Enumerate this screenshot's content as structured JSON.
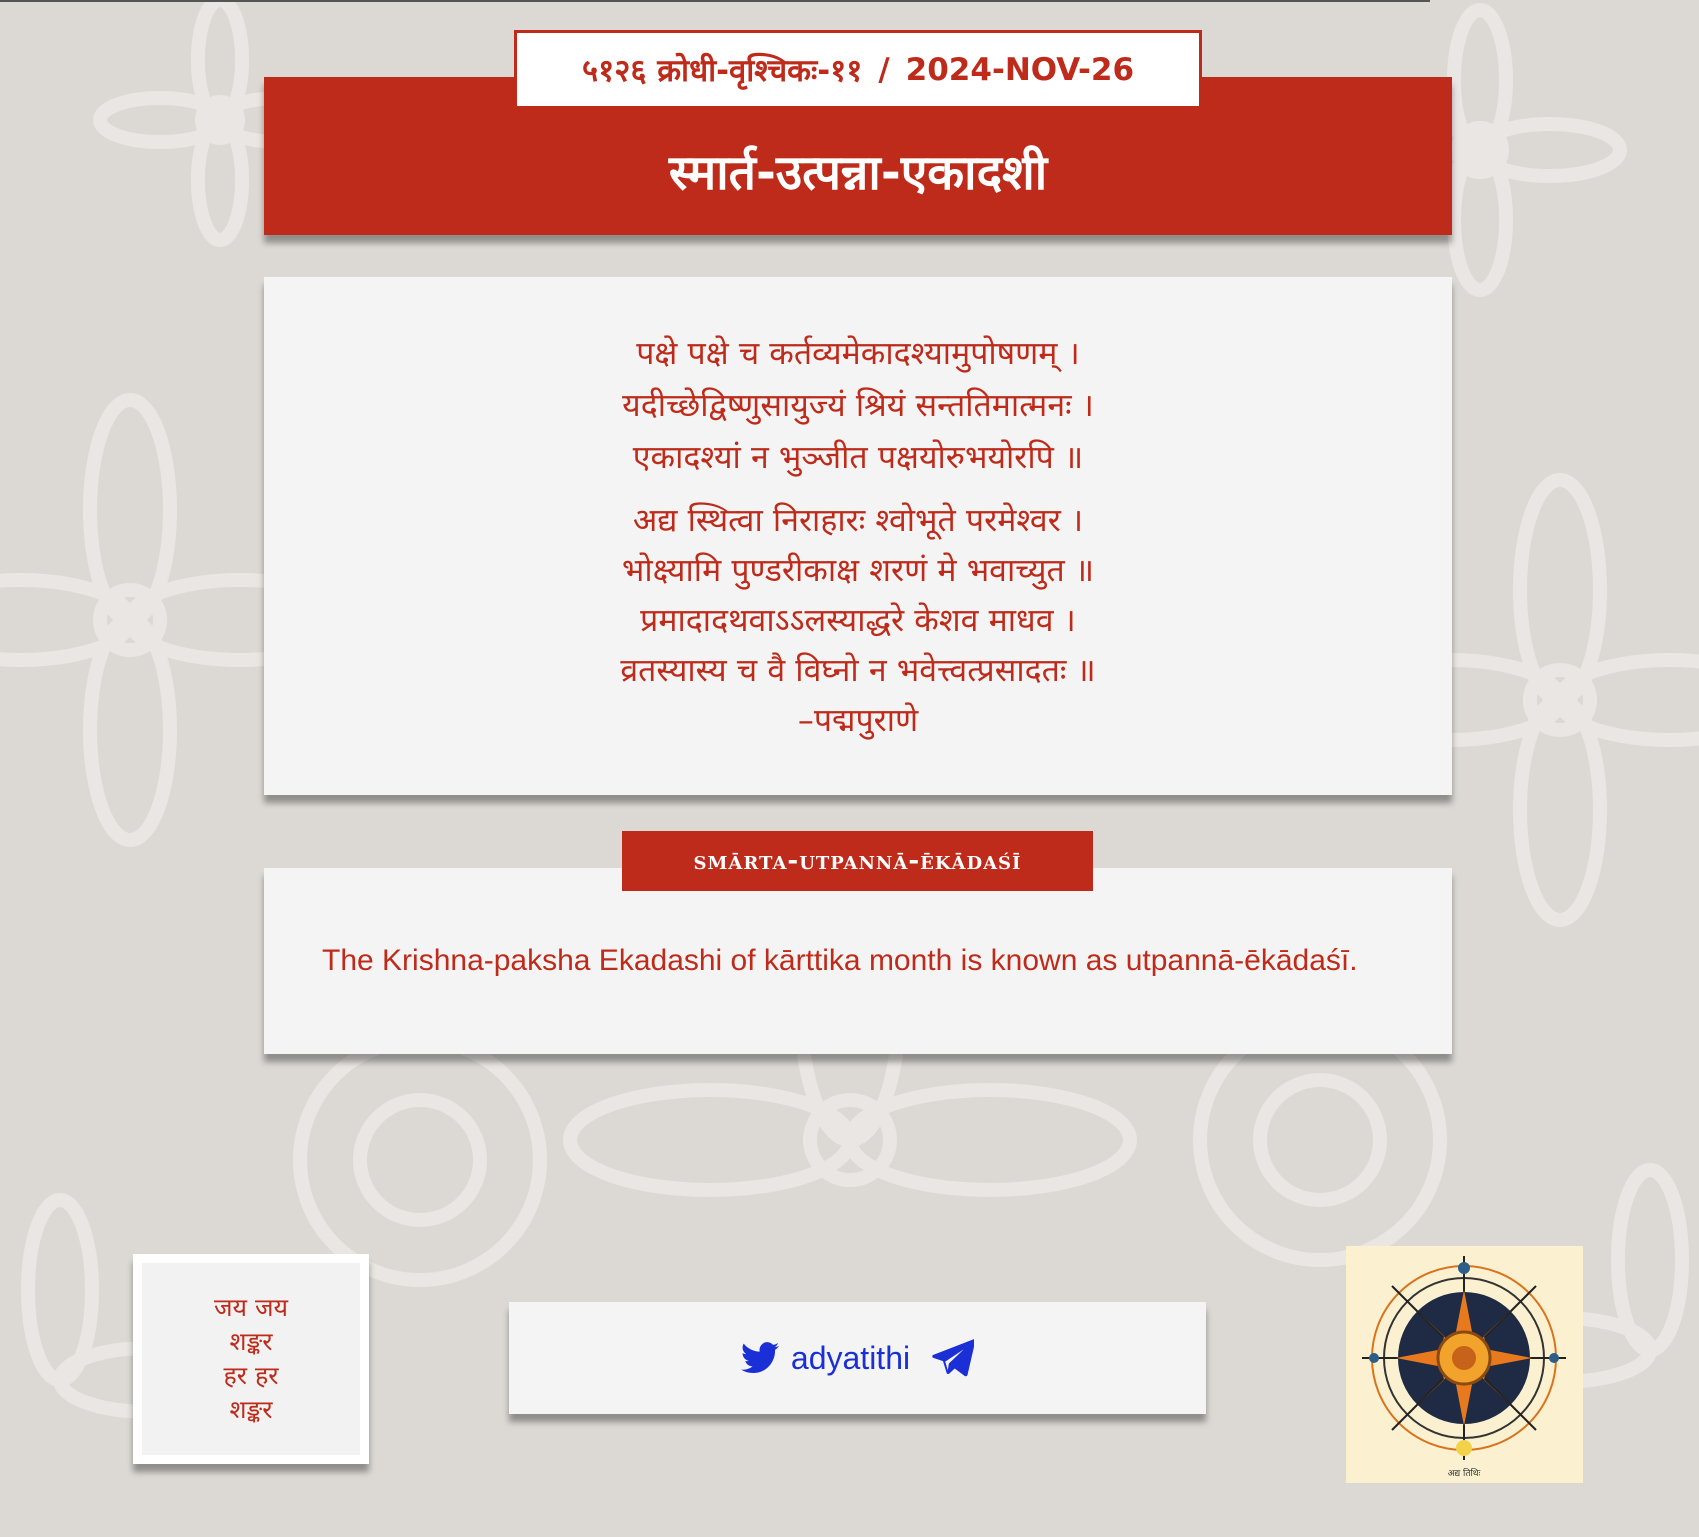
{
  "header": {
    "date_samvat": "५१२६ क्रोधी-वृश्चिकः-११",
    "separator": "/",
    "date_gregorian": "2024-NOV-26",
    "title": "स्मार्त-उत्पन्ना-एकादशी"
  },
  "verse": {
    "stanza1": [
      "पक्षे पक्षे च कर्तव्यमेकादश्यामुपोषणम् ।",
      "यदीच्छेद्विष्णुसायुज्यं श्रियं सन्ततिमात्मनः ।",
      "एकादश्यां न भुञ्जीत पक्षयोरुभयोरपि ॥"
    ],
    "stanza2": [
      "अद्य स्थित्वा निराहारः श्वोभूते परमेश्वर ।",
      "भोक्ष्यामि पुण्डरीकाक्ष शरणं मे भवाच्युत ॥",
      "प्रमादादथवाऽऽलस्याद्धरे केशव माधव ।",
      "व्रतस्यास्य च वै विघ्नो न भवेत्त्वत्प्रसादतः ॥",
      "–पद्मपुराणे"
    ]
  },
  "section": {
    "badge": "smārta-utpannā-ēkādaśī",
    "description": "The Krishna-paksha Ekadashi of kārttika month is known as utpannā-ēkādaśī."
  },
  "footer": {
    "jaya_lines": [
      "जय जय",
      "शङ्कर",
      "हर हर",
      "शङ्कर"
    ],
    "social_handle": "adyatithi",
    "logo_caption": "अद्य तिथिः"
  },
  "colors": {
    "accent": "#be2b1b",
    "background": "#dcd9d4",
    "card": "#f4f4f4",
    "link": "#1a2fd6"
  },
  "icons": [
    "twitter-icon",
    "telegram-icon",
    "compass-sun-logo"
  ]
}
